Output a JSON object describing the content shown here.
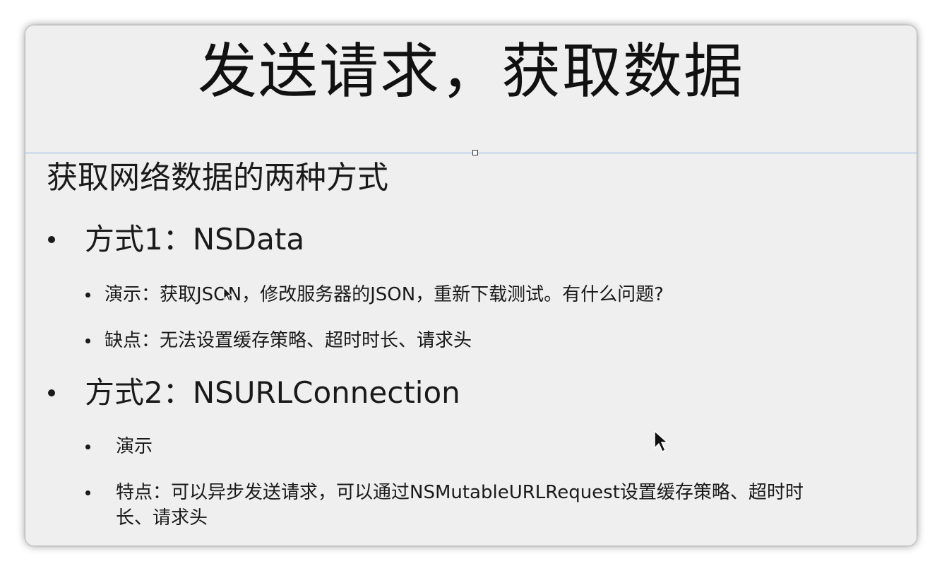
{
  "slide": {
    "title": "发送请求，获取数据",
    "subtitle": "获取网络数据的两种方式",
    "method1": {
      "heading": "方式1：NSData",
      "points": [
        "演示：获取JSON，修改服务器的JSON，重新下载测试。有什么问题?",
        "缺点：无法设置缓存策略、超时时长、请求头"
      ]
    },
    "method2": {
      "heading": "方式2：NSURLConnection",
      "points": [
        "演示",
        "特点：可以异步发送请求，可以通过NSMutableURLRequest设置缓存策略、超时时",
        "长、请求头"
      ]
    }
  },
  "colors": {
    "slide_background": "#efefef",
    "selection_line": "#8fb3e8",
    "text": "#1a1a1a"
  },
  "icons": [
    "mouse-pointer-icon",
    "mouse-pointer-icon"
  ]
}
